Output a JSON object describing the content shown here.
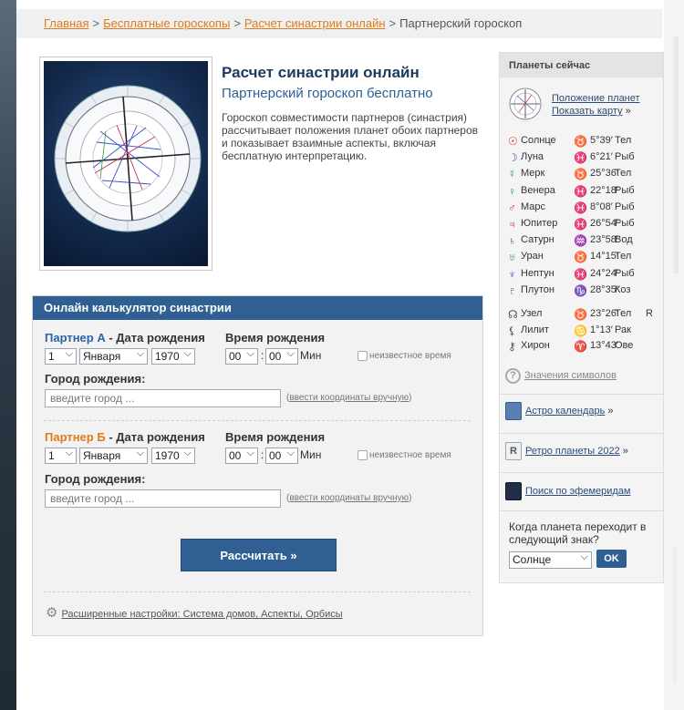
{
  "breadcrumb": {
    "home": "Главная",
    "free": "Бесплатные гороскопы",
    "synastry": "Расчет синастрии онлайн",
    "current": "Партнерский гороскоп",
    "sep": ">"
  },
  "hero": {
    "title": "Расчет синастрии онлайн",
    "subtitle": "Партнерский гороскоп бесплатно",
    "description": "Гороскоп совместимости партнеров (синастрия) рассчитывает положения планет обоих партнеров и показывает взаимные аспекты, включая бесплатную интерпретацию."
  },
  "calc": {
    "header": "Онлайн калькулятор синастрии",
    "partner_a": "Партнер А",
    "partner_b": "Партнер Б",
    "dob_suffix": "- Дата рождения",
    "time_label": "Время рождения",
    "day": "1",
    "month": "Января",
    "year": "1970",
    "hour": "00",
    "minute": "00",
    "colon": ":",
    "min": "Мин",
    "unknown_time": "неизвестное время",
    "city_label": "Город рождения:",
    "city_placeholder": "введите город ...",
    "manual_coords": "ввести координаты вручную",
    "submit": "Рассчитать »",
    "advanced": "Расширенные настройки: Система домов, Аспекты, Орбисы"
  },
  "sidebar": {
    "header": "Планеты сейчас",
    "positions_link": "Положение планет",
    "show_map_link": "Показать карту",
    "planets": [
      {
        "glyph": "☉",
        "name": "Солнце",
        "zodiac": "♉",
        "deg": "5°39′",
        "sign": "Тел",
        "retro": ""
      },
      {
        "glyph": "☽",
        "name": "Луна",
        "zodiac": "♓",
        "deg": "6°21′",
        "sign": "Рыб",
        "retro": ""
      },
      {
        "glyph": "☿",
        "name": "Мерк",
        "zodiac": "♉",
        "deg": "25°36′",
        "sign": "Тел",
        "retro": ""
      },
      {
        "glyph": "♀",
        "name": "Венера",
        "zodiac": "♓",
        "deg": "22°18′",
        "sign": "Рыб",
        "retro": ""
      },
      {
        "glyph": "♂",
        "name": "Марс",
        "zodiac": "♓",
        "deg": "8°08′",
        "sign": "Рыб",
        "retro": ""
      },
      {
        "glyph": "♃",
        "name": "Юпитер",
        "zodiac": "♓",
        "deg": "26°54′",
        "sign": "Рыб",
        "retro": ""
      },
      {
        "glyph": "♄",
        "name": "Сатурн",
        "zodiac": "♒",
        "deg": "23°58′",
        "sign": "Вод",
        "retro": ""
      },
      {
        "glyph": "♅",
        "name": "Уран",
        "zodiac": "♉",
        "deg": "14°15′",
        "sign": "Тел",
        "retro": ""
      },
      {
        "glyph": "♆",
        "name": "Нептун",
        "zodiac": "♓",
        "deg": "24°24′",
        "sign": "Рыб",
        "retro": ""
      },
      {
        "glyph": "♇",
        "name": "Плутон",
        "zodiac": "♑",
        "deg": "28°35′",
        "sign": "Коз",
        "retro": ""
      }
    ],
    "points": [
      {
        "glyph": "☊",
        "name": "Узел",
        "zodiac": "♉",
        "deg": "23°26′",
        "sign": "Тел",
        "retro": "R"
      },
      {
        "glyph": "⚸",
        "name": "Лилит",
        "zodiac": "♋",
        "deg": "1°13′",
        "sign": "Рак",
        "retro": ""
      },
      {
        "glyph": "⚷",
        "name": "Хирон",
        "zodiac": "♈",
        "deg": "13°43′",
        "sign": "Ове",
        "retro": ""
      }
    ],
    "symbols_link": "Значения символов",
    "astro_calendar": "Астро календарь",
    "retro_planets": "Ретро планеты 2022",
    "ephemeris": "Поиск по эфемеридам",
    "question": "Когда планета переходит в следующий знак?",
    "planet_select": "Солнце",
    "ok": "OK"
  },
  "colors": {
    "accent_orange": "#e07b1a",
    "primary_blue": "#2f5f93"
  }
}
